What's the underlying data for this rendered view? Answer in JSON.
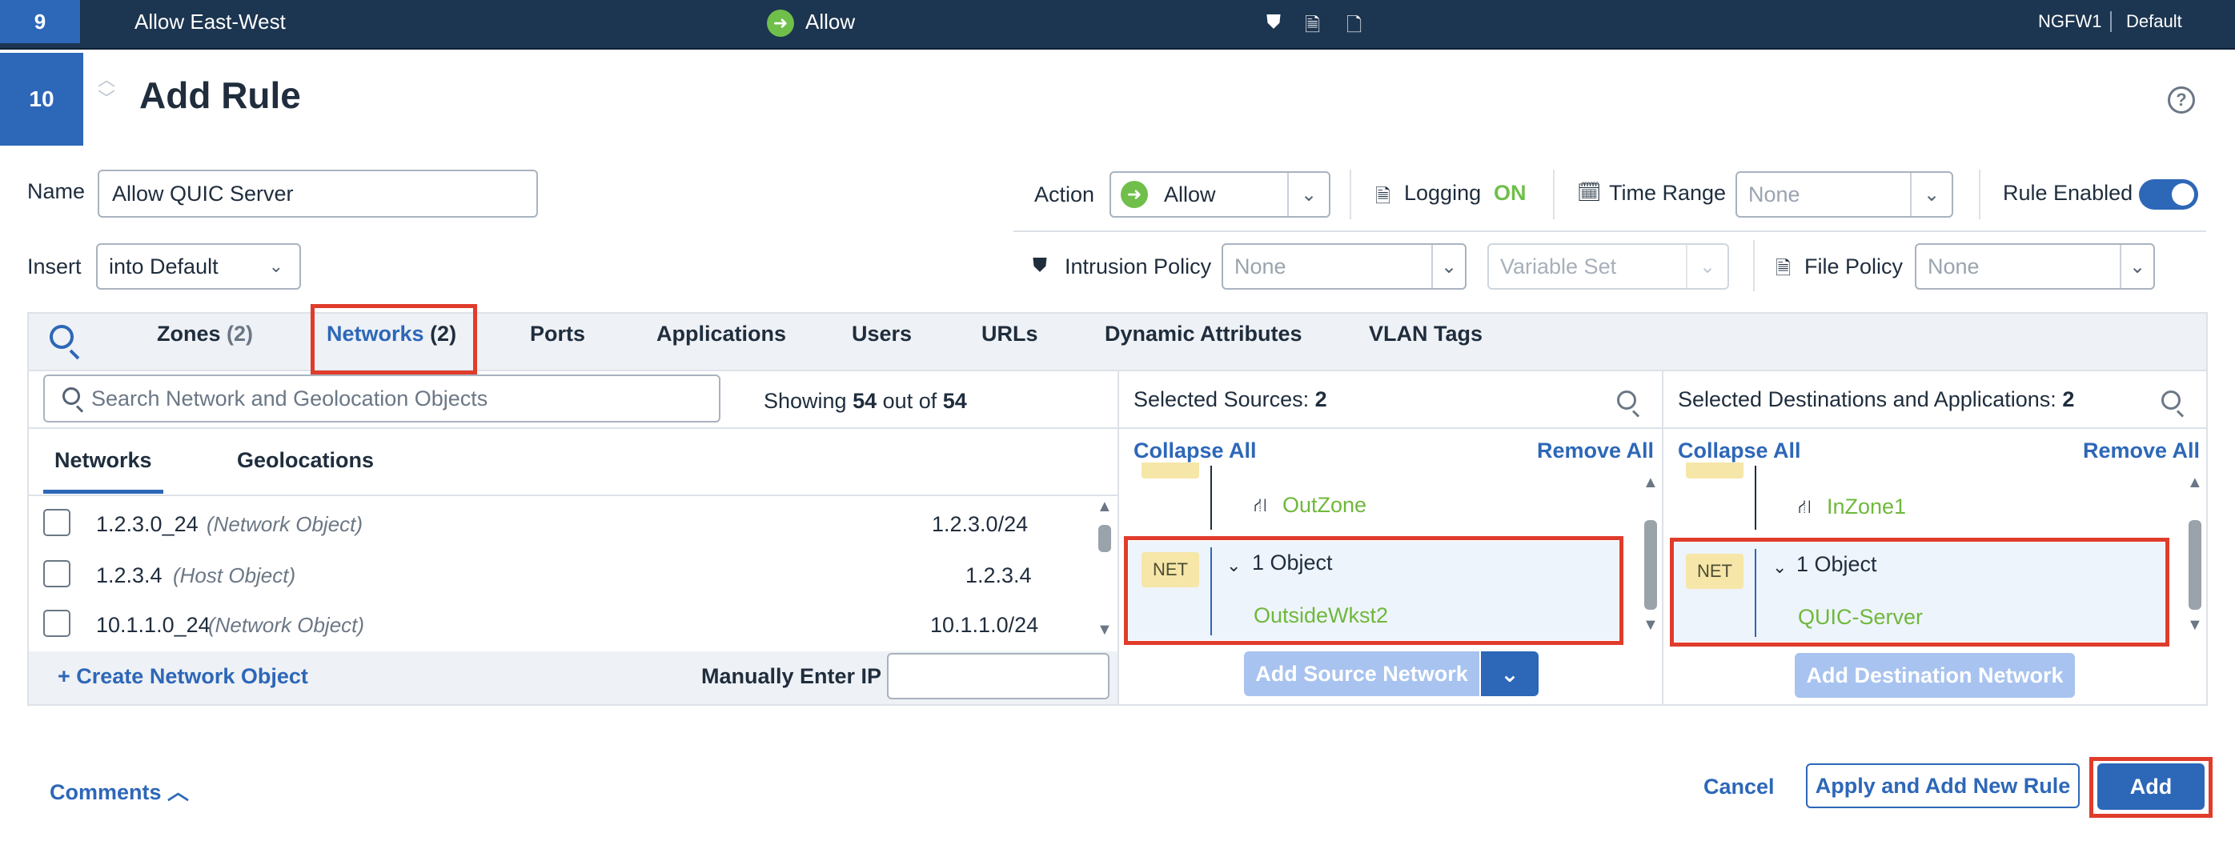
{
  "prev_row": {
    "number": "9",
    "name": "Allow East-West",
    "action": "Allow",
    "device": "NGFW1",
    "policy": "Default"
  },
  "dialog": {
    "number": "10",
    "title": "Add Rule",
    "name_label": "Name",
    "name_value": "Allow QUIC Server",
    "insert_label": "Insert",
    "insert_value": "into Default",
    "action_label": "Action",
    "action_value": "Allow",
    "logging_label": "Logging",
    "logging_value": "ON",
    "time_range_label": "Time Range",
    "time_range_value": "None",
    "rule_enabled_label": "Rule Enabled",
    "intrusion_label": "Intrusion Policy",
    "intrusion_value": "None",
    "variable_set_placeholder": "Variable Set",
    "file_policy_label": "File Policy",
    "file_policy_value": "None"
  },
  "tabs": [
    {
      "label": "Zones",
      "count": "(2)"
    },
    {
      "label": "Networks",
      "count": "(2)"
    },
    {
      "label": "Ports"
    },
    {
      "label": "Applications"
    },
    {
      "label": "Users"
    },
    {
      "label": "URLs"
    },
    {
      "label": "Dynamic Attributes"
    },
    {
      "label": "VLAN Tags"
    }
  ],
  "left": {
    "search_placeholder": "Search Network and Geolocation Objects",
    "showing_prefix": "Showing",
    "showing_count": "54",
    "showing_mid": "out of",
    "showing_total": "54",
    "subtabs": [
      "Networks",
      "Geolocations"
    ],
    "rows": [
      {
        "name": "1.2.3.0_24",
        "type": "(Network Object)",
        "value": "1.2.3.0/24"
      },
      {
        "name": "1.2.3.4",
        "type": "(Host Object)",
        "value": "1.2.3.4"
      },
      {
        "name": "10.1.1.0_24",
        "type": "(Network Object)",
        "value": "10.1.1.0/24"
      }
    ],
    "create_link": "+ Create Network Object",
    "manual_ip_label": "Manually Enter IP"
  },
  "sources": {
    "header_label": "Selected Sources:",
    "header_count": "2",
    "collapse_all": "Collapse All",
    "remove_all": "Remove All",
    "zone_item": "OutZone",
    "badge": "NET",
    "group_label": "1 Object",
    "object": "OutsideWkst2",
    "add_button": "Add Source Network"
  },
  "destinations": {
    "header_label": "Selected Destinations and Applications:",
    "header_count": "2",
    "collapse_all": "Collapse All",
    "remove_all": "Remove All",
    "zone_item": "InZone1",
    "badge": "NET",
    "group_label": "1 Object",
    "object": "QUIC-Server",
    "add_button": "Add Destination Network"
  },
  "footer": {
    "comments": "Comments",
    "cancel": "Cancel",
    "apply_add": "Apply and Add New Rule",
    "add": "Add"
  },
  "colors": {
    "accent": "#2d67b8",
    "allow_green": "#6fbf4a",
    "highlight_red": "#e03c2c",
    "object_green": "#6fb83b"
  }
}
